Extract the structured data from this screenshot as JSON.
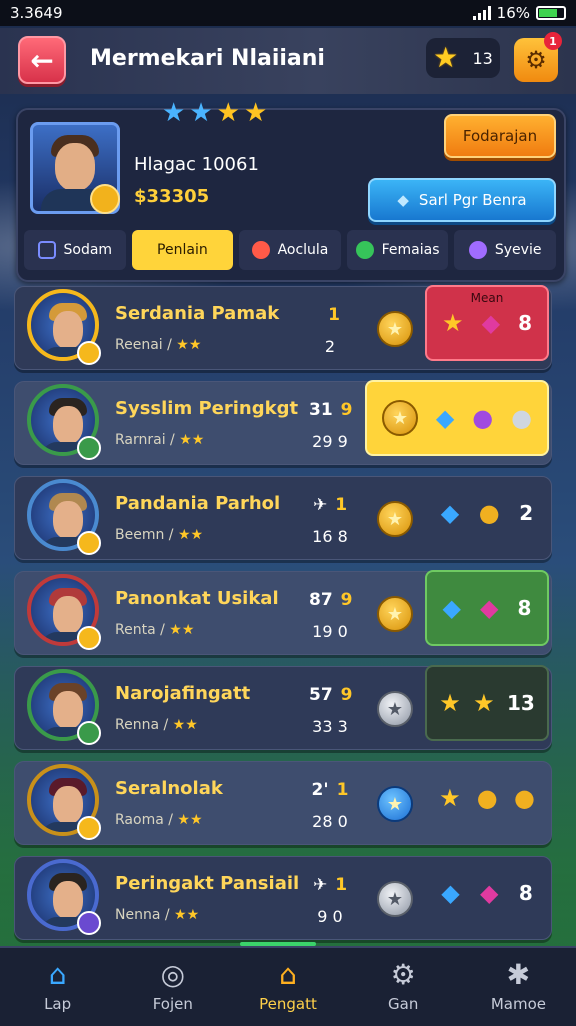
{
  "status": {
    "time": "3.3649",
    "battery": "16%"
  },
  "header": {
    "title": "Mermekari Nlaiiani",
    "coins": "13",
    "notif": "1"
  },
  "profile": {
    "name": "Hlagac 10061",
    "coins": "$33305",
    "orange_button": "Fodarajan",
    "blue_button": "Sarl Pgr Benra",
    "tabs": [
      {
        "label": "Sodam",
        "color": "#7a8cff"
      },
      {
        "label": "Penlain",
        "color": "#ffd43a"
      },
      {
        "label": "Aoclula",
        "color": "#ff5a48"
      },
      {
        "label": "Femaias",
        "color": "#36c45a"
      },
      {
        "label": "Syevie",
        "color": "#a06cff"
      }
    ]
  },
  "rows": [
    {
      "name": "Serdania Pamak",
      "sub": "Reenai /",
      "top": "1",
      "bottom": "2",
      "coin": "gold",
      "reward": {
        "style": "red",
        "label": "Mean",
        "items": [
          "★",
          "◆"
        ],
        "value": "8"
      }
    },
    {
      "name": "Sysslim Peringkgt",
      "sub": "Rarnrai /",
      "top_a": "31",
      "top": "9",
      "bottom_a": "29",
      "bottom": "9",
      "coin": "gold",
      "reward": {
        "style": "gold",
        "items": [
          "◆",
          "●",
          "●"
        ],
        "value": ""
      }
    },
    {
      "name": "Pandania Parhol",
      "sub": "Beemn /",
      "top_a": "✈",
      "top": "1",
      "bottom_a": "16",
      "bottom": "8",
      "coin": "gold",
      "reward": {
        "style": "none",
        "items": [
          "◆",
          "●"
        ],
        "value": "2"
      }
    },
    {
      "name": "Panonkat Usikal",
      "sub": "Renta /",
      "top_a": "87",
      "top": "9",
      "bottom_a": "19",
      "bottom": "0",
      "coin": "gold",
      "reward": {
        "style": "green",
        "items": [
          "◆",
          "◆"
        ],
        "value": "8"
      }
    },
    {
      "name": "Narojafingatt",
      "sub": "Renna /",
      "top_a": "57",
      "top": "9",
      "bottom_a": "33",
      "bottom": "3",
      "coin": "silver",
      "reward": {
        "style": "dark",
        "items": [
          "★",
          "★"
        ],
        "value": "13"
      }
    },
    {
      "name": "Seralnolak",
      "sub": "Raoma /",
      "top_a": "2'",
      "top": "1",
      "bottom_a": "28",
      "bottom": "0",
      "coin": "blue",
      "reward": {
        "style": "none",
        "items": [
          "★",
          "●",
          "●"
        ],
        "value": ""
      }
    },
    {
      "name": "Peringakt Pansiail",
      "sub": "Nenna /",
      "top_a": "✈",
      "top": "1",
      "bottom_a": "9",
      "bottom": "0",
      "coin": "silver",
      "reward": {
        "style": "none",
        "items": [
          "◆",
          "◆"
        ],
        "value": "8"
      }
    }
  ],
  "nav": [
    {
      "label": "Lap",
      "icon": "home-icon"
    },
    {
      "label": "Fojen",
      "icon": "compass-icon"
    },
    {
      "label": "Pengatt",
      "icon": "house-icon"
    },
    {
      "label": "Gan",
      "icon": "gear-icon"
    },
    {
      "label": "Mamoe",
      "icon": "cog-icon"
    }
  ]
}
